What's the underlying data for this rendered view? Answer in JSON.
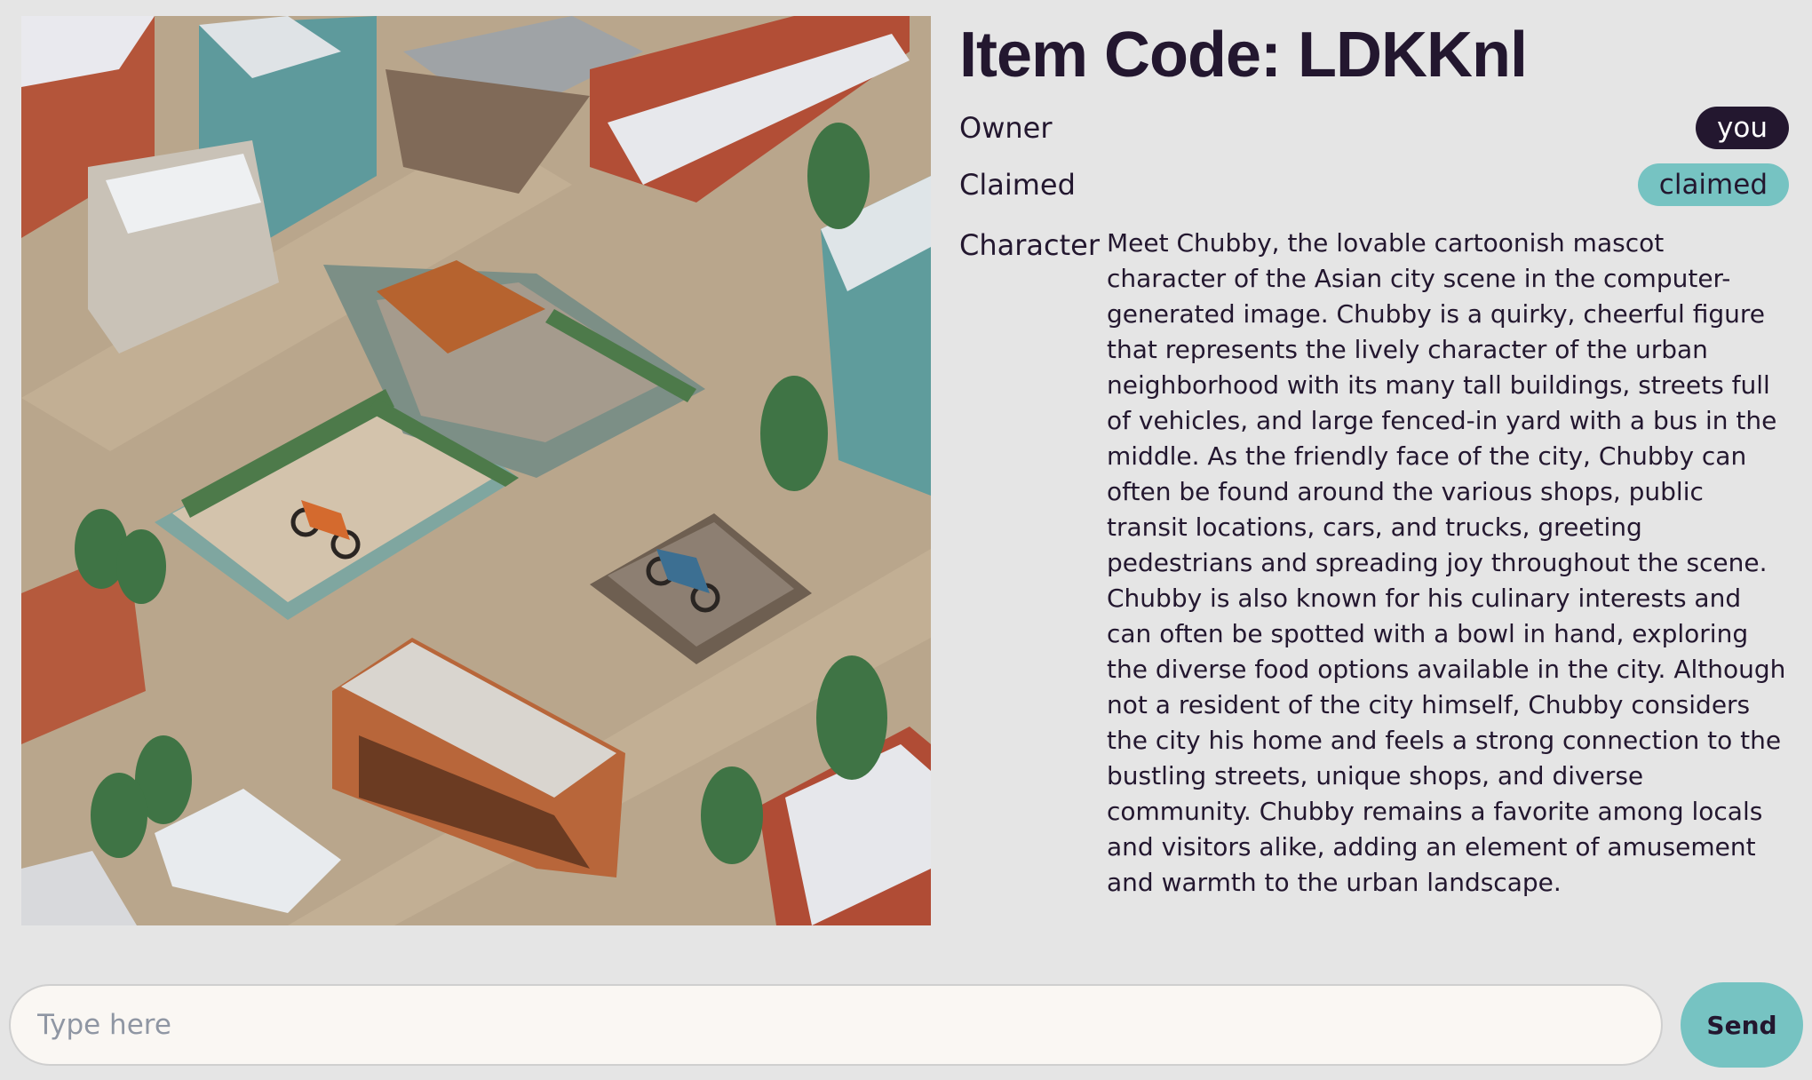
{
  "item": {
    "title": "Item Code: LDKKnl"
  },
  "details": {
    "owner_label": "Owner",
    "owner_value": "you",
    "claimed_label": "Claimed",
    "claimed_value": "claimed",
    "character_label": "Character",
    "character_text": "Meet Chubby, the lovable cartoonish mascot character of the Asian city scene in the computer-generated image. Chubby is a quirky, cheerful figure that represents the lively character of the urban neighborhood with its many tall buildings, streets full of vehicles, and large fenced-in yard with a bus in the middle. As the friendly face of the city, Chubby can often be found around the various shops, public transit locations, cars, and trucks, greeting pedestrians and spreading joy throughout the scene. Chubby is also known for his culinary interests and can often be spotted with a bowl in hand, exploring the diverse food options available in the city. Although not a resident of the city himself, Chubby considers the city his home and feels a strong connection to the bustling streets, unique shops, and diverse community. Chubby remains a favorite among locals and visitors alike, adding an element of amusement and warmth to the urban landscape."
  },
  "chat": {
    "input_value": "",
    "placeholder": "Type here",
    "send_label": "Send"
  },
  "colors": {
    "background": "#e5e5e5",
    "primary_dark": "#23172f",
    "accent_teal": "#76c3c2",
    "input_background": "#faf7f3"
  }
}
